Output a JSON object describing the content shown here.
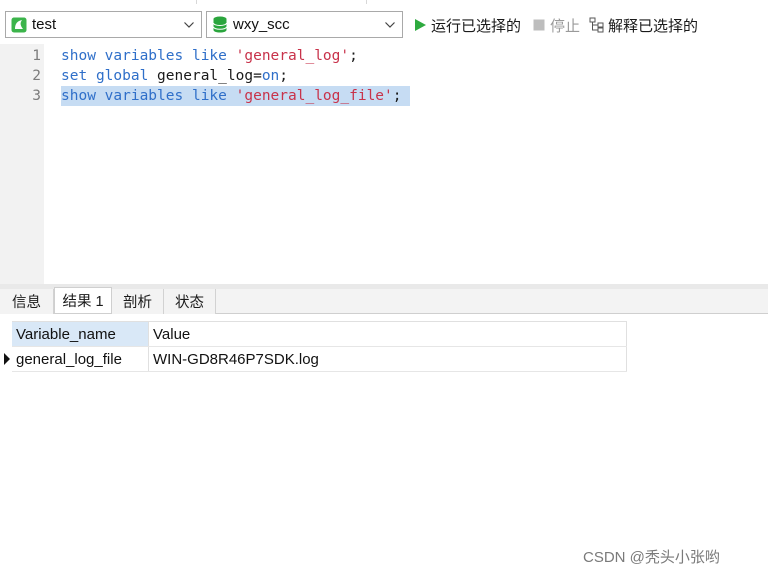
{
  "toolbar": {
    "connection": {
      "value": "test",
      "icon": "connection-icon"
    },
    "database": {
      "value": "wxy_scc",
      "icon": "database-icon"
    },
    "run_selected_label": "运行已选择的",
    "stop_label": "停止",
    "explain_selected_label": "解释已选择的"
  },
  "editor": {
    "lines": [
      {
        "number": "1",
        "text": "show variables like 'general_log';"
      },
      {
        "number": "2",
        "text": "set global general_log=on;"
      },
      {
        "number": "3",
        "text": "show variables like 'general_log_file';"
      }
    ],
    "selected_line": 3,
    "colors": {
      "keyword": "#2f6fc9",
      "string": "#c8324a",
      "selection": "#c6dcf3"
    }
  },
  "tabs": [
    {
      "label": "信息",
      "active": false
    },
    {
      "label": "结果 1",
      "active": true
    },
    {
      "label": "剖析",
      "active": false
    },
    {
      "label": "状态",
      "active": false
    }
  ],
  "results": {
    "columns": [
      "Variable_name",
      "Value"
    ],
    "rows": [
      [
        "general_log_file",
        "WIN-GD8R46P7SDK.log"
      ]
    ]
  },
  "watermark": "CSDN @秃头小张哟"
}
